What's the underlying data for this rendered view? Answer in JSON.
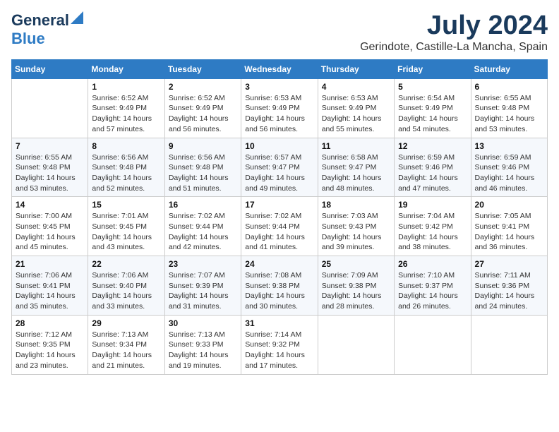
{
  "header": {
    "logo_line1": "General",
    "logo_line2": "Blue",
    "month": "July 2024",
    "location": "Gerindote, Castille-La Mancha, Spain"
  },
  "weekdays": [
    "Sunday",
    "Monday",
    "Tuesday",
    "Wednesday",
    "Thursday",
    "Friday",
    "Saturday"
  ],
  "weeks": [
    [
      {
        "day": "",
        "sunrise": "",
        "sunset": "",
        "daylight": ""
      },
      {
        "day": "1",
        "sunrise": "Sunrise: 6:52 AM",
        "sunset": "Sunset: 9:49 PM",
        "daylight": "Daylight: 14 hours and 57 minutes."
      },
      {
        "day": "2",
        "sunrise": "Sunrise: 6:52 AM",
        "sunset": "Sunset: 9:49 PM",
        "daylight": "Daylight: 14 hours and 56 minutes."
      },
      {
        "day": "3",
        "sunrise": "Sunrise: 6:53 AM",
        "sunset": "Sunset: 9:49 PM",
        "daylight": "Daylight: 14 hours and 56 minutes."
      },
      {
        "day": "4",
        "sunrise": "Sunrise: 6:53 AM",
        "sunset": "Sunset: 9:49 PM",
        "daylight": "Daylight: 14 hours and 55 minutes."
      },
      {
        "day": "5",
        "sunrise": "Sunrise: 6:54 AM",
        "sunset": "Sunset: 9:49 PM",
        "daylight": "Daylight: 14 hours and 54 minutes."
      },
      {
        "day": "6",
        "sunrise": "Sunrise: 6:55 AM",
        "sunset": "Sunset: 9:48 PM",
        "daylight": "Daylight: 14 hours and 53 minutes."
      }
    ],
    [
      {
        "day": "7",
        "sunrise": "Sunrise: 6:55 AM",
        "sunset": "Sunset: 9:48 PM",
        "daylight": "Daylight: 14 hours and 53 minutes."
      },
      {
        "day": "8",
        "sunrise": "Sunrise: 6:56 AM",
        "sunset": "Sunset: 9:48 PM",
        "daylight": "Daylight: 14 hours and 52 minutes."
      },
      {
        "day": "9",
        "sunrise": "Sunrise: 6:56 AM",
        "sunset": "Sunset: 9:48 PM",
        "daylight": "Daylight: 14 hours and 51 minutes."
      },
      {
        "day": "10",
        "sunrise": "Sunrise: 6:57 AM",
        "sunset": "Sunset: 9:47 PM",
        "daylight": "Daylight: 14 hours and 49 minutes."
      },
      {
        "day": "11",
        "sunrise": "Sunrise: 6:58 AM",
        "sunset": "Sunset: 9:47 PM",
        "daylight": "Daylight: 14 hours and 48 minutes."
      },
      {
        "day": "12",
        "sunrise": "Sunrise: 6:59 AM",
        "sunset": "Sunset: 9:46 PM",
        "daylight": "Daylight: 14 hours and 47 minutes."
      },
      {
        "day": "13",
        "sunrise": "Sunrise: 6:59 AM",
        "sunset": "Sunset: 9:46 PM",
        "daylight": "Daylight: 14 hours and 46 minutes."
      }
    ],
    [
      {
        "day": "14",
        "sunrise": "Sunrise: 7:00 AM",
        "sunset": "Sunset: 9:45 PM",
        "daylight": "Daylight: 14 hours and 45 minutes."
      },
      {
        "day": "15",
        "sunrise": "Sunrise: 7:01 AM",
        "sunset": "Sunset: 9:45 PM",
        "daylight": "Daylight: 14 hours and 43 minutes."
      },
      {
        "day": "16",
        "sunrise": "Sunrise: 7:02 AM",
        "sunset": "Sunset: 9:44 PM",
        "daylight": "Daylight: 14 hours and 42 minutes."
      },
      {
        "day": "17",
        "sunrise": "Sunrise: 7:02 AM",
        "sunset": "Sunset: 9:44 PM",
        "daylight": "Daylight: 14 hours and 41 minutes."
      },
      {
        "day": "18",
        "sunrise": "Sunrise: 7:03 AM",
        "sunset": "Sunset: 9:43 PM",
        "daylight": "Daylight: 14 hours and 39 minutes."
      },
      {
        "day": "19",
        "sunrise": "Sunrise: 7:04 AM",
        "sunset": "Sunset: 9:42 PM",
        "daylight": "Daylight: 14 hours and 38 minutes."
      },
      {
        "day": "20",
        "sunrise": "Sunrise: 7:05 AM",
        "sunset": "Sunset: 9:41 PM",
        "daylight": "Daylight: 14 hours and 36 minutes."
      }
    ],
    [
      {
        "day": "21",
        "sunrise": "Sunrise: 7:06 AM",
        "sunset": "Sunset: 9:41 PM",
        "daylight": "Daylight: 14 hours and 35 minutes."
      },
      {
        "day": "22",
        "sunrise": "Sunrise: 7:06 AM",
        "sunset": "Sunset: 9:40 PM",
        "daylight": "Daylight: 14 hours and 33 minutes."
      },
      {
        "day": "23",
        "sunrise": "Sunrise: 7:07 AM",
        "sunset": "Sunset: 9:39 PM",
        "daylight": "Daylight: 14 hours and 31 minutes."
      },
      {
        "day": "24",
        "sunrise": "Sunrise: 7:08 AM",
        "sunset": "Sunset: 9:38 PM",
        "daylight": "Daylight: 14 hours and 30 minutes."
      },
      {
        "day": "25",
        "sunrise": "Sunrise: 7:09 AM",
        "sunset": "Sunset: 9:38 PM",
        "daylight": "Daylight: 14 hours and 28 minutes."
      },
      {
        "day": "26",
        "sunrise": "Sunrise: 7:10 AM",
        "sunset": "Sunset: 9:37 PM",
        "daylight": "Daylight: 14 hours and 26 minutes."
      },
      {
        "day": "27",
        "sunrise": "Sunrise: 7:11 AM",
        "sunset": "Sunset: 9:36 PM",
        "daylight": "Daylight: 14 hours and 24 minutes."
      }
    ],
    [
      {
        "day": "28",
        "sunrise": "Sunrise: 7:12 AM",
        "sunset": "Sunset: 9:35 PM",
        "daylight": "Daylight: 14 hours and 23 minutes."
      },
      {
        "day": "29",
        "sunrise": "Sunrise: 7:13 AM",
        "sunset": "Sunset: 9:34 PM",
        "daylight": "Daylight: 14 hours and 21 minutes."
      },
      {
        "day": "30",
        "sunrise": "Sunrise: 7:13 AM",
        "sunset": "Sunset: 9:33 PM",
        "daylight": "Daylight: 14 hours and 19 minutes."
      },
      {
        "day": "31",
        "sunrise": "Sunrise: 7:14 AM",
        "sunset": "Sunset: 9:32 PM",
        "daylight": "Daylight: 14 hours and 17 minutes."
      },
      {
        "day": "",
        "sunrise": "",
        "sunset": "",
        "daylight": ""
      },
      {
        "day": "",
        "sunrise": "",
        "sunset": "",
        "daylight": ""
      },
      {
        "day": "",
        "sunrise": "",
        "sunset": "",
        "daylight": ""
      }
    ]
  ]
}
